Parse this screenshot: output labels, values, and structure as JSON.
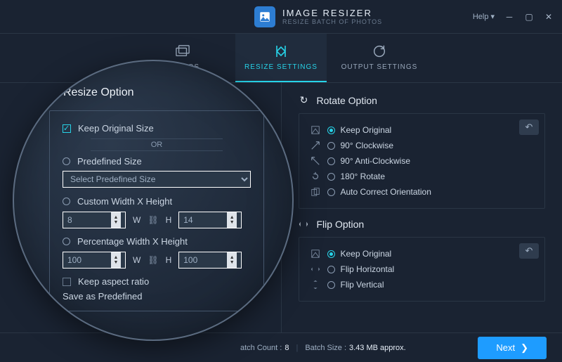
{
  "app": {
    "title": "IMAGE RESIZER",
    "subtitle": "RESIZE BATCH OF PHOTOS",
    "help_label": "Help"
  },
  "tabs": {
    "photos": "PHOTOS",
    "resize": "RESIZE SETTINGS",
    "output": "OUTPUT SETTINGS"
  },
  "resize": {
    "heading": "Resize Option",
    "keep_original": "Keep Original Size",
    "or": "OR",
    "predefined": "Predefined Size",
    "predefined_placeholder": "Select Predefined Size",
    "custom": "Custom Width X Height",
    "custom_w": "8",
    "custom_h": "14",
    "percentage": "Percentage Width X Height",
    "percent_w": "100",
    "percent_h": "100",
    "w_label": "W",
    "h_label": "H",
    "keep_aspect": "Keep aspect ratio",
    "save_predef": "Save as Predefined"
  },
  "rotate": {
    "heading": "Rotate Option",
    "items": [
      {
        "label": "Keep Original",
        "selected": true
      },
      {
        "label": "90° Clockwise",
        "selected": false
      },
      {
        "label": "90° Anti-Clockwise",
        "selected": false
      },
      {
        "label": "180° Rotate",
        "selected": false
      },
      {
        "label": "Auto Correct Orientation",
        "selected": false
      }
    ]
  },
  "flip": {
    "heading": "Flip Option",
    "items": [
      {
        "label": "Keep Original",
        "selected": true
      },
      {
        "label": "Flip Horizontal",
        "selected": false
      },
      {
        "label": "Flip Vertical",
        "selected": false
      }
    ]
  },
  "footer": {
    "batch_count_label": "atch Count :",
    "batch_count": "8",
    "batch_size_label": "Batch Size :",
    "batch_size": "3.43 MB approx.",
    "next": "Next"
  }
}
